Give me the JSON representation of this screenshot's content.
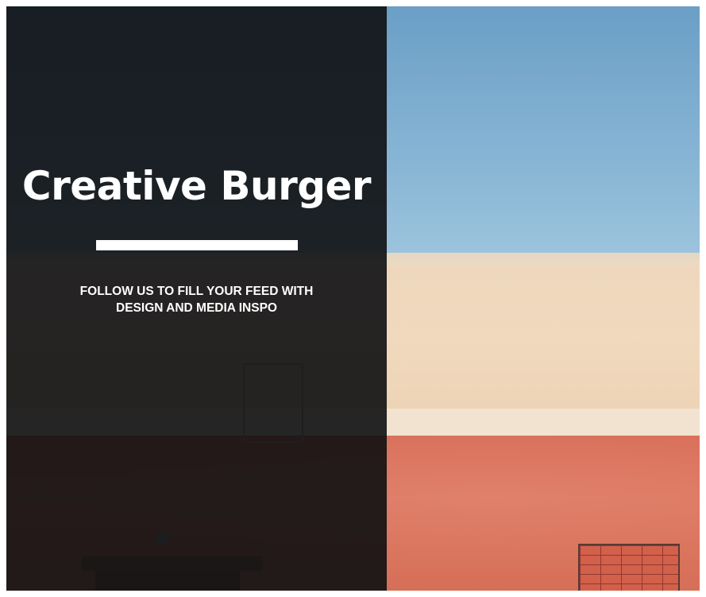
{
  "title": "Creative Burger",
  "tagline_line1": "FOLLOW US TO FILL YOUR FEED WITH",
  "tagline_line2": "DESIGN AND MEDIA INSPO",
  "colors": {
    "overlay": "#0e1012",
    "sky": "#86b4d4",
    "wall_cream": "#f0d9bd",
    "wall_red": "#de7a63",
    "text": "#ffffff"
  }
}
